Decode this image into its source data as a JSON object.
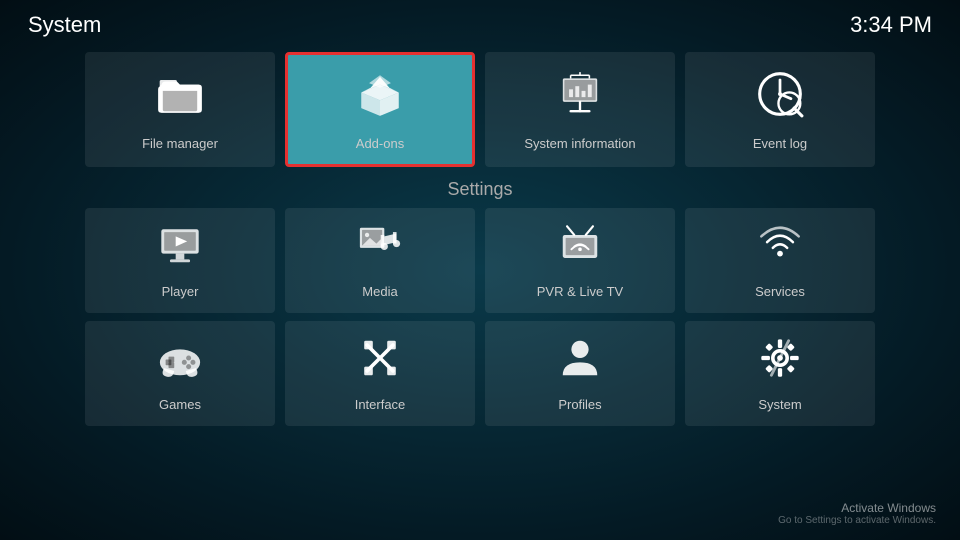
{
  "header": {
    "title": "System",
    "time": "3:34 PM"
  },
  "top_row": {
    "tiles": [
      {
        "id": "file-manager",
        "label": "File manager"
      },
      {
        "id": "add-ons",
        "label": "Add-ons",
        "active": true
      },
      {
        "id": "system-information",
        "label": "System information"
      },
      {
        "id": "event-log",
        "label": "Event log"
      }
    ]
  },
  "settings": {
    "section_title": "Settings",
    "row1": [
      {
        "id": "player",
        "label": "Player"
      },
      {
        "id": "media",
        "label": "Media"
      },
      {
        "id": "pvr-live-tv",
        "label": "PVR & Live TV"
      },
      {
        "id": "services",
        "label": "Services"
      }
    ],
    "row2": [
      {
        "id": "games",
        "label": "Games"
      },
      {
        "id": "interface",
        "label": "Interface"
      },
      {
        "id": "profiles",
        "label": "Profiles"
      },
      {
        "id": "system",
        "label": "System"
      }
    ]
  },
  "watermark": {
    "title": "Activate Windows",
    "subtitle": "Go to Settings to activate Windows."
  }
}
